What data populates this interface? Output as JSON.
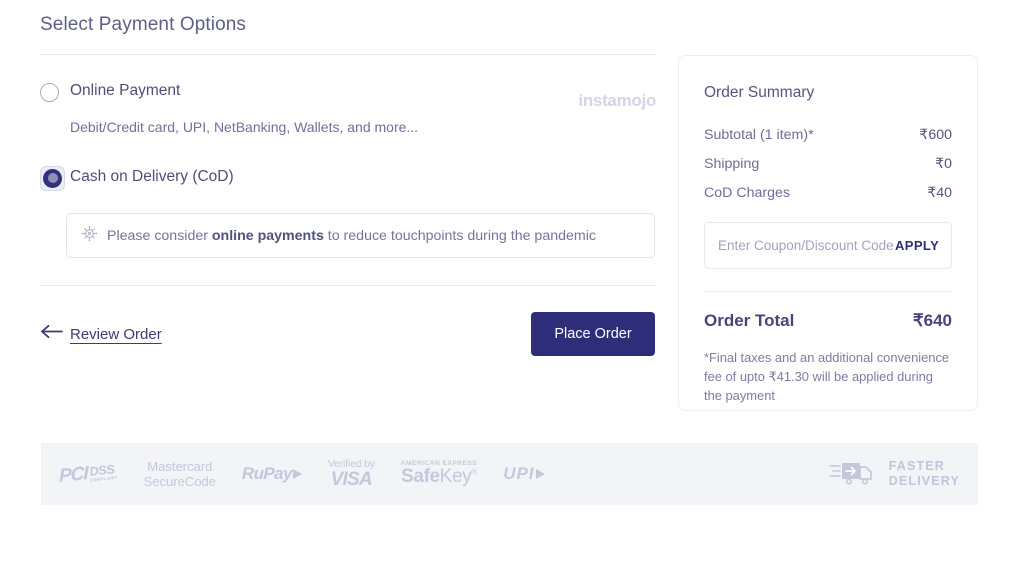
{
  "page": {
    "title": "Select Payment Options"
  },
  "payment_options": [
    {
      "id": "online-payment",
      "label": "Online Payment",
      "sub": "Debit/Credit card, UPI, NetBanking, Wallets, and more...",
      "selected": false,
      "brand": "instamojo"
    },
    {
      "id": "cash-on-delivery",
      "label": "Cash on Delivery (CoD)",
      "selected": true
    }
  ],
  "notice": {
    "icon": "virus-icon",
    "text_before": "Please consider ",
    "text_bold": "online payments",
    "text_after": " to reduce touchpoints during the pandemic"
  },
  "actions": {
    "back_label": "Review Order",
    "back_icon": "arrow-left-icon",
    "place_order_label": "Place Order"
  },
  "summary": {
    "title": "Order Summary",
    "rows": [
      {
        "label": "Subtotal (1 item)*",
        "value": "₹600"
      },
      {
        "label": "Shipping",
        "value": "₹0"
      },
      {
        "label": "CoD Charges",
        "value": "₹40"
      }
    ],
    "coupon": {
      "placeholder": "Enter Coupon/Discount Code",
      "value": "",
      "apply_label": "APPLY"
    },
    "total_label": "Order Total",
    "total_value": "₹640",
    "fine_print": "*Final taxes and an additional convenience fee of upto ₹41.30  will be applied during the payment"
  },
  "footer": {
    "badges": {
      "pci_word": "PCI",
      "pci_dss": "DSS",
      "pci_compliant": "COMPLIANT",
      "mastercard_line1": "Mastercard",
      "mastercard_line2": "SecureCode",
      "rupay": "RuPay",
      "visa_top": "Verified by",
      "visa_main": "VISA",
      "amex_top": "AMERICAN EXPRESS",
      "safekey_safe": "Safe",
      "safekey_key": "Key",
      "safekey_mark": "®",
      "upi": "UPI"
    },
    "faster_line1": "FASTER",
    "faster_line2": "DELIVERY",
    "truck_icon": "delivery-truck-icon"
  },
  "colors": {
    "accent": "#2e2d7a",
    "text": "#55567f",
    "muted": "#7c7da2",
    "badge": "#c5c7dc",
    "footer_bg": "#f3f4f8"
  }
}
